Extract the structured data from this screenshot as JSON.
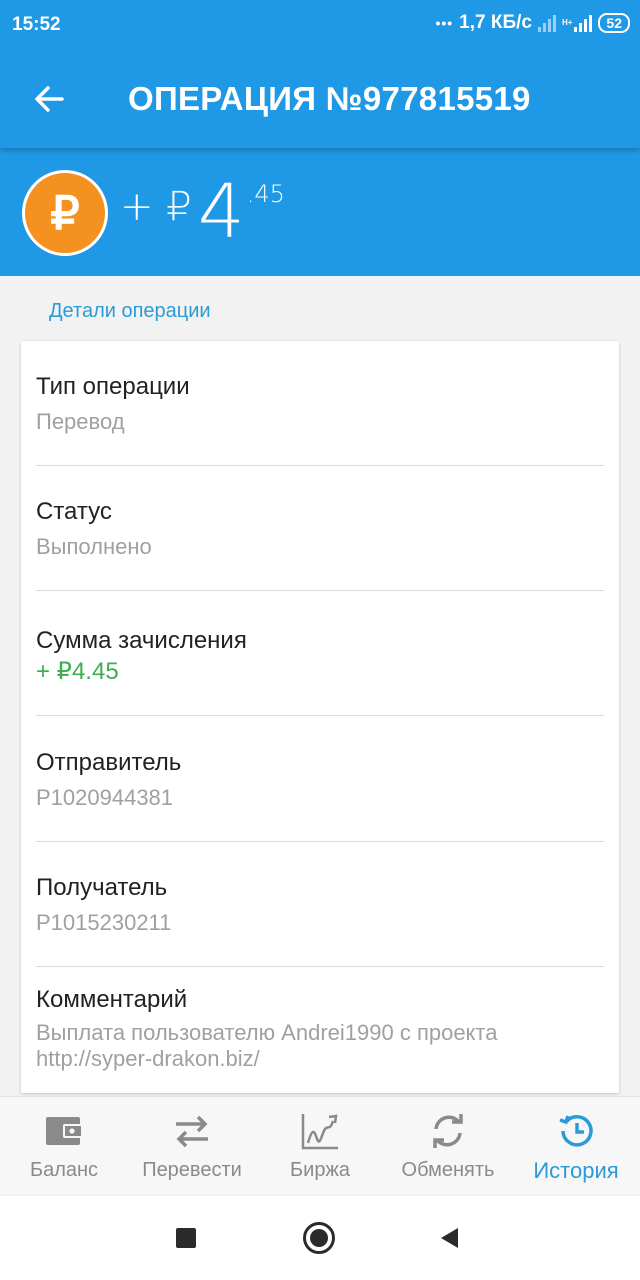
{
  "status_bar": {
    "time": "15:52",
    "network_speed": "1,7 КБ/с",
    "network_type": "H+",
    "battery": "52"
  },
  "app_bar": {
    "back_icon": "arrow-left-icon",
    "title": "ОПЕРАЦИЯ №977815519"
  },
  "hero": {
    "currency_icon": "ruble-coin-icon",
    "currency_symbol": "₽",
    "sign": "+ ₽",
    "amount_int": "4",
    "amount_cents": ".45"
  },
  "details": {
    "section_title": "Детали операции",
    "rows": [
      {
        "label": "Тип операции",
        "value": "Перевод"
      },
      {
        "label": "Статус",
        "value": "Выполнено"
      },
      {
        "label": "Сумма зачисления",
        "value": "+ ₽4.45"
      },
      {
        "label": "Отправитель",
        "value": "P1020944381"
      },
      {
        "label": "Получатель",
        "value": "P1015230211"
      },
      {
        "label": "Комментарий",
        "value": "Выплата пользователю Andrei1990 с проекта http://syper-drakon.biz/"
      }
    ]
  },
  "tabs": [
    {
      "label": "Баланс",
      "icon": "wallet-icon"
    },
    {
      "label": "Перевести",
      "icon": "transfer-arrows-icon"
    },
    {
      "label": "Биржа",
      "icon": "chart-icon"
    },
    {
      "label": "Обменять",
      "icon": "exchange-refresh-icon"
    },
    {
      "label": "История",
      "icon": "history-icon",
      "active": true
    }
  ],
  "colors": {
    "primary": "#1f98e6",
    "accent": "#2a9bd6",
    "coin": "#f5911e",
    "positive": "#3fae4e"
  },
  "system_nav": [
    "recents-square-icon",
    "home-circle-icon",
    "back-triangle-icon"
  ]
}
